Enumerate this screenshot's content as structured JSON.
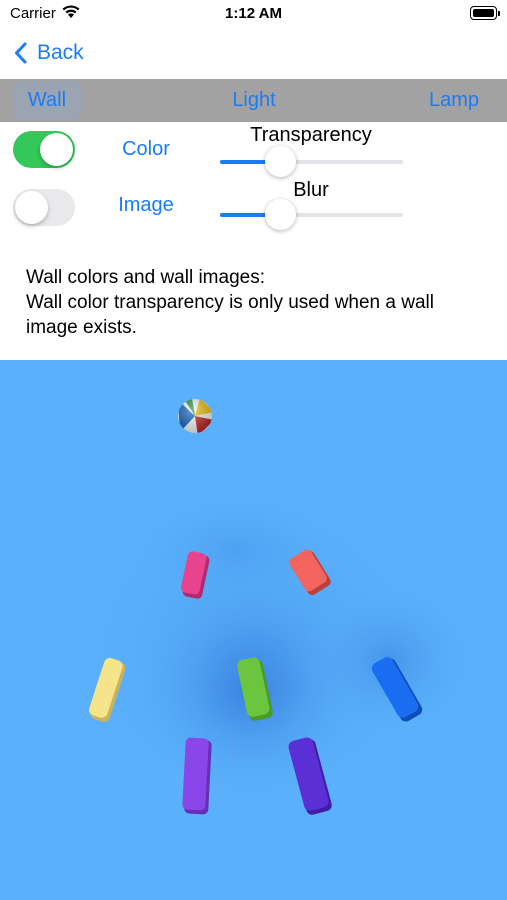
{
  "status_bar": {
    "carrier": "Carrier",
    "time": "1:12 AM"
  },
  "nav": {
    "back_label": "Back"
  },
  "tabs": [
    {
      "label": "Wall",
      "selected": true
    },
    {
      "label": "Light",
      "selected": false
    },
    {
      "label": "Lamp",
      "selected": false
    }
  ],
  "controls": {
    "color": {
      "label": "Color",
      "toggle_on": true
    },
    "image": {
      "label": "Image",
      "toggle_on": false
    },
    "transparency": {
      "label": "Transparency",
      "value": 0.33
    },
    "blur": {
      "label": "Blur",
      "value": 0.33
    }
  },
  "description": {
    "line1": "Wall colors and wall images:",
    "line2": "Wall color transparency is only used when a wall",
    "line3": "image exists."
  },
  "colors": {
    "accent": "#1a7cf5",
    "toggle_on": "#34c759",
    "tabbar_bg": "#a2a2a2",
    "scene_bg": "#5ab0fa"
  },
  "scene": {
    "ball": "beach-ball",
    "tiles": [
      {
        "name": "pink-tile",
        "color": "#e8438e"
      },
      {
        "name": "coral-tile",
        "color": "#f2655e"
      },
      {
        "name": "yellow-tile",
        "color": "#f6e48a"
      },
      {
        "name": "green-tile",
        "color": "#6cc53e"
      },
      {
        "name": "blue-tile",
        "color": "#1a6df0"
      },
      {
        "name": "purple-tile",
        "color": "#8a46e8"
      },
      {
        "name": "indigo-tile",
        "color": "#5a2fd6"
      }
    ]
  }
}
